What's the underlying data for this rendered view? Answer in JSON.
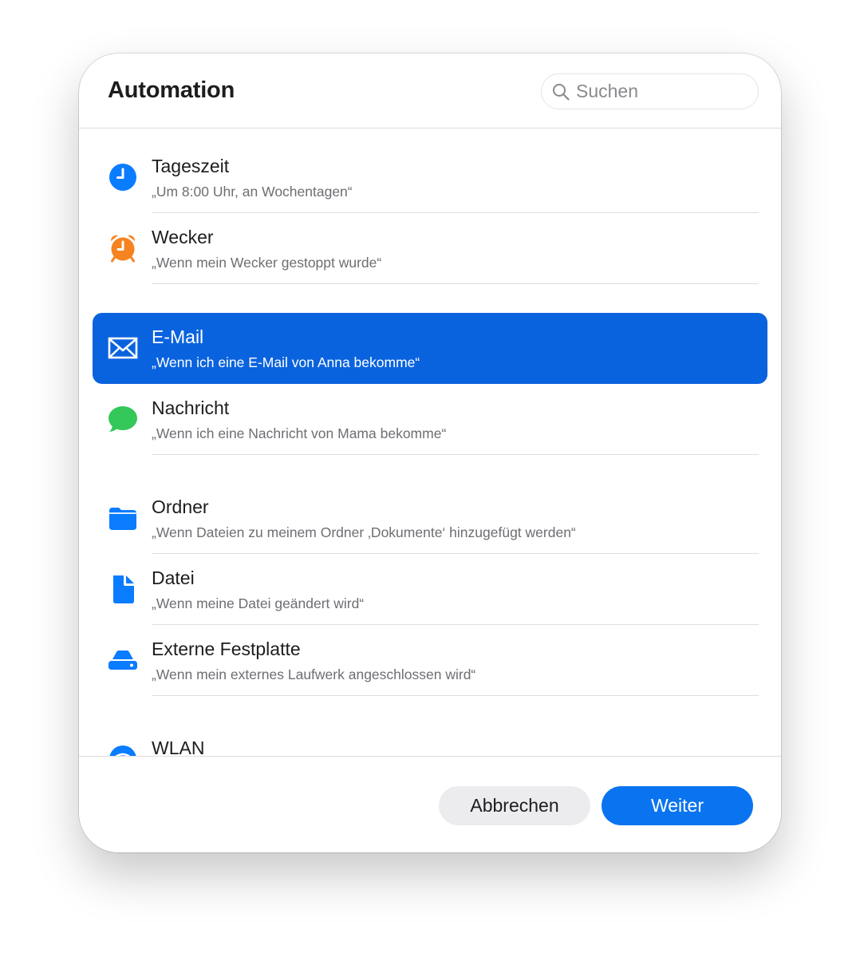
{
  "dialog": {
    "title": "Automation",
    "search": {
      "placeholder": "Suchen",
      "value": ""
    }
  },
  "items": [
    {
      "label": "Tageszeit",
      "desc": "„Um 8:00 Uhr, an Wochentagen“",
      "icon": "clock-icon",
      "color": "#0a7cff"
    },
    {
      "label": "Wecker",
      "desc": "„Wenn mein Wecker gestoppt wurde“",
      "icon": "alarm-clock-icon",
      "color": "#f5831f"
    },
    {
      "label": "E-Mail",
      "desc": "„Wenn ich eine E-Mail von Anna bekomme“",
      "icon": "envelope-icon",
      "color": "#ffffff",
      "selected": true
    },
    {
      "label": "Nachricht",
      "desc": "„Wenn ich eine Nachricht von Mama bekomme“",
      "icon": "message-bubble-icon",
      "color": "#34c759"
    },
    {
      "label": "Ordner",
      "desc": "„Wenn Dateien zu meinem Ordner ‚Dokumente‘ hinzugefügt werden“",
      "icon": "folder-icon",
      "color": "#0a7cff"
    },
    {
      "label": "Datei",
      "desc": "„Wenn meine Datei geändert wird“",
      "icon": "document-icon",
      "color": "#0a7cff"
    },
    {
      "label": "Externe Festplatte",
      "desc": "„Wenn mein externes Laufwerk angeschlossen wird“",
      "icon": "external-drive-icon",
      "color": "#0a7cff"
    },
    {
      "label": "WLAN",
      "desc": "",
      "icon": "wifi-icon",
      "color": "#0a7cff"
    }
  ],
  "footer": {
    "cancel_label": "Abbrechen",
    "next_label": "Weiter"
  },
  "colors": {
    "accent": "#0a74f0",
    "selection": "#0a63de"
  }
}
